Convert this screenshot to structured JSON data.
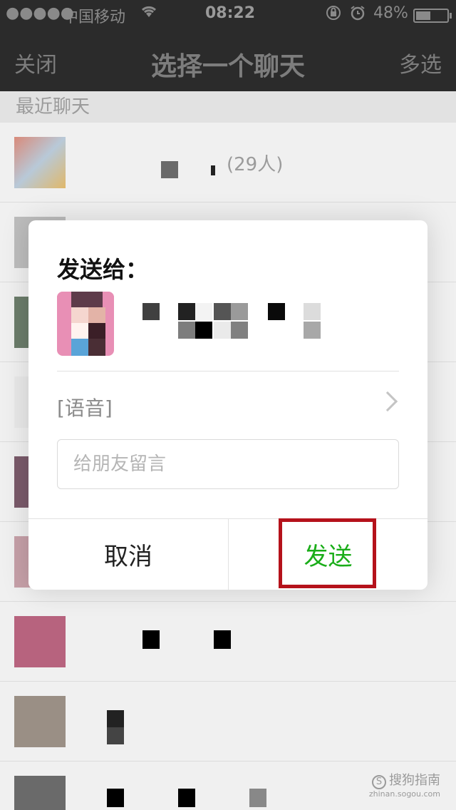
{
  "status_bar": {
    "signal_dots": "●●●●●",
    "carrier": "中国移动",
    "time": "08:22",
    "battery_percent": "48%",
    "battery_level": 0.48,
    "icons": [
      "wifi-icon",
      "orientation-lock-icon",
      "alarm-icon",
      "battery-icon"
    ]
  },
  "nav": {
    "left": "关闭",
    "title": "选择一个聊天",
    "right": "多选"
  },
  "list": {
    "section_header": "最近聊天",
    "rows": [
      {
        "name_suffix": "(29人)"
      },
      {
        "name_suffix": ""
      },
      {
        "name_suffix": ""
      },
      {
        "name_suffix": ""
      },
      {
        "name_suffix": ""
      },
      {
        "name_suffix": ""
      },
      {
        "name_suffix": ""
      },
      {
        "name_suffix": ""
      },
      {
        "name_suffix": ""
      }
    ]
  },
  "dialog": {
    "title": "发送给：",
    "content_preview": "[语音]",
    "message_placeholder": "给朋友留言",
    "cancel_label": "取消",
    "send_label": "发送"
  },
  "colors": {
    "send_green": "#1aad19",
    "highlight_red": "#b5121b",
    "nav_background": "#2b2b2b"
  },
  "watermark": {
    "line1": "搜狗指南",
    "line2": "zhinan.sogou.com"
  }
}
